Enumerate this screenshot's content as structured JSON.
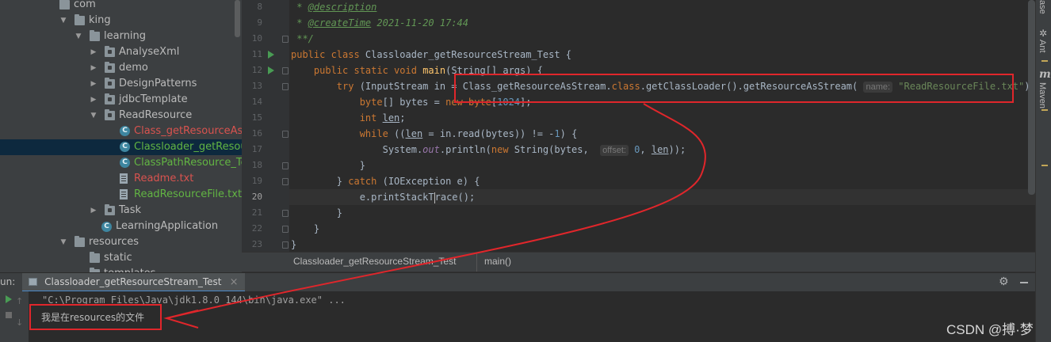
{
  "project_tree": {
    "rows": [
      {
        "label": "com",
        "type": "folder",
        "indent": 0,
        "arrow": "",
        "color": "default",
        "partial": true
      },
      {
        "label": "king",
        "type": "folder",
        "indent": 1,
        "arrow": "down",
        "color": "default"
      },
      {
        "label": "learning",
        "type": "folder",
        "indent": 2,
        "arrow": "down",
        "color": "default"
      },
      {
        "label": "AnalyseXml",
        "type": "folder",
        "indent": 3,
        "arrow": "right",
        "color": "default"
      },
      {
        "label": "demo",
        "type": "folder",
        "indent": 3,
        "arrow": "right",
        "color": "default"
      },
      {
        "label": "DesignPatterns",
        "type": "folder",
        "indent": 3,
        "arrow": "right",
        "color": "default"
      },
      {
        "label": "jdbcTemplate",
        "type": "folder",
        "indent": 3,
        "arrow": "right",
        "color": "default"
      },
      {
        "label": "ReadResource",
        "type": "folder",
        "indent": 3,
        "arrow": "down",
        "color": "default"
      },
      {
        "label": "Class_getResourceAsStr",
        "type": "class",
        "indent": 4,
        "arrow": "",
        "color": "red"
      },
      {
        "label": "Classloader_getResourc",
        "type": "class",
        "indent": 4,
        "arrow": "",
        "color": "green",
        "selected": true
      },
      {
        "label": "ClassPathResource_Test",
        "type": "class",
        "indent": 4,
        "arrow": "",
        "color": "green"
      },
      {
        "label": "Readme.txt",
        "type": "file",
        "indent": 4,
        "arrow": "",
        "color": "red"
      },
      {
        "label": "ReadResourceFile.txt",
        "type": "file",
        "indent": 4,
        "arrow": "",
        "color": "green"
      },
      {
        "label": "Task",
        "type": "folder",
        "indent": 3,
        "arrow": "right",
        "color": "default"
      },
      {
        "label": "LearningApplication",
        "type": "app",
        "indent": 3,
        "arrow": "",
        "color": "default"
      },
      {
        "label": "resources",
        "type": "folder",
        "indent": 1,
        "arrow": "down",
        "color": "default"
      },
      {
        "label": "static",
        "type": "folder",
        "indent": 2,
        "arrow": "",
        "color": "default"
      },
      {
        "label": "templates",
        "type": "folder",
        "indent": 2,
        "arrow": "",
        "color": "default"
      }
    ]
  },
  "editor": {
    "current_line": "20",
    "lines": [
      {
        "no": "8",
        "run": false,
        "fold": false,
        "tokens": [
          [
            "cm",
            " * "
          ],
          [
            "tag",
            "@description"
          ]
        ]
      },
      {
        "no": "9",
        "run": false,
        "fold": false,
        "tokens": [
          [
            "cm",
            " * "
          ],
          [
            "tag",
            "@createTime"
          ],
          [
            "cm",
            " 2021-11-20 17:44"
          ]
        ]
      },
      {
        "no": "10",
        "run": false,
        "fold": true,
        "tokens": [
          [
            "cm",
            " **/"
          ]
        ]
      },
      {
        "no": "11",
        "run": true,
        "fold": false,
        "tokens": [
          [
            "kw",
            "public class "
          ],
          [
            "",
            "Classloader_getResourceStream_Test {"
          ]
        ]
      },
      {
        "no": "12",
        "run": true,
        "fold": true,
        "tokens": [
          [
            "",
            "    "
          ],
          [
            "kw",
            "public static void "
          ],
          [
            "fn",
            "main"
          ],
          [
            "",
            "(String[] args) {"
          ]
        ]
      },
      {
        "no": "13",
        "run": false,
        "fold": true,
        "tokens": [
          [
            "",
            "        "
          ],
          [
            "kw",
            "try "
          ],
          [
            "",
            "(InputStream in = Class_getResourceAsStream."
          ],
          [
            "kw",
            "class"
          ],
          [
            "",
            ".getClassLoader().getResourceAsStream( "
          ],
          [
            "hint",
            "name:"
          ],
          [
            "",
            ""
          ],
          [
            "str",
            " \"ReadResourceFile.txt\""
          ],
          [
            "",
            "))  {"
          ]
        ]
      },
      {
        "no": "14",
        "run": false,
        "fold": false,
        "tokens": [
          [
            "",
            "            "
          ],
          [
            "kw",
            "byte"
          ],
          [
            "",
            "[] bytes = "
          ],
          [
            "kw",
            "new byte"
          ],
          [
            "",
            "["
          ],
          [
            "num",
            "1024"
          ],
          [
            "",
            "];"
          ]
        ]
      },
      {
        "no": "15",
        "run": false,
        "fold": false,
        "tokens": [
          [
            "",
            "            "
          ],
          [
            "kw",
            "int "
          ],
          [
            "und",
            "len"
          ],
          [
            "",
            ";"
          ]
        ]
      },
      {
        "no": "16",
        "run": false,
        "fold": true,
        "tokens": [
          [
            "",
            "            "
          ],
          [
            "kw",
            "while "
          ],
          [
            "",
            "(("
          ],
          [
            "und",
            "len"
          ],
          [
            "",
            " = in."
          ],
          [
            "",
            "read"
          ],
          [
            "",
            "(bytes)) != -"
          ],
          [
            "num",
            "1"
          ],
          [
            "",
            ") {"
          ]
        ]
      },
      {
        "no": "17",
        "run": false,
        "fold": false,
        "tokens": [
          [
            "",
            "                System."
          ],
          [
            "fld",
            "out"
          ],
          [
            "",
            ".println("
          ],
          [
            "kw",
            "new "
          ],
          [
            "",
            "String(bytes,  "
          ],
          [
            "hint",
            "offset:"
          ],
          [
            "",
            ""
          ],
          [
            "num",
            " 0"
          ],
          [
            "",
            ", "
          ],
          [
            "und",
            "len"
          ],
          [
            "",
            "));"
          ]
        ]
      },
      {
        "no": "18",
        "run": false,
        "fold": true,
        "tokens": [
          [
            "",
            "            }"
          ]
        ]
      },
      {
        "no": "19",
        "run": false,
        "fold": true,
        "tokens": [
          [
            "",
            "        } "
          ],
          [
            "kw",
            "catch "
          ],
          [
            "",
            "(IOException e) {"
          ]
        ]
      },
      {
        "no": "20",
        "run": false,
        "fold": false,
        "tokens": [
          [
            "",
            "            e.printStackT"
          ],
          [
            "caret",
            ""
          ],
          [
            "",
            "race();"
          ]
        ]
      },
      {
        "no": "21",
        "run": false,
        "fold": true,
        "tokens": [
          [
            "",
            "        }"
          ]
        ]
      },
      {
        "no": "22",
        "run": false,
        "fold": true,
        "tokens": [
          [
            "",
            "    }"
          ]
        ]
      },
      {
        "no": "23",
        "run": false,
        "fold": true,
        "tokens": [
          [
            "",
            "}"
          ]
        ]
      }
    ]
  },
  "breadcrumbs": {
    "class": "Classloader_getResourceStream_Test",
    "method": "main()"
  },
  "right_strip": {
    "top_label": "ase",
    "ant": "Ant",
    "maven_icon": "m",
    "maven": "Maven"
  },
  "run_panel": {
    "prefix": "un:",
    "tab_label": "Classloader_getResourceStream_Test",
    "tab_close": "×",
    "command": "\"C:\\Program Files\\Java\\jdk1.8.0_144\\bin\\java.exe\" ...",
    "output": "我是在resources的文件",
    "settings_icon": "gear-icon",
    "minimize_icon": "minimize-icon"
  },
  "watermark": "CSDN @搏·梦",
  "colors": {
    "annotation_red": "#e0262b",
    "run_green": "#499c54",
    "keyword": "#cc7832",
    "string": "#6a8759"
  }
}
